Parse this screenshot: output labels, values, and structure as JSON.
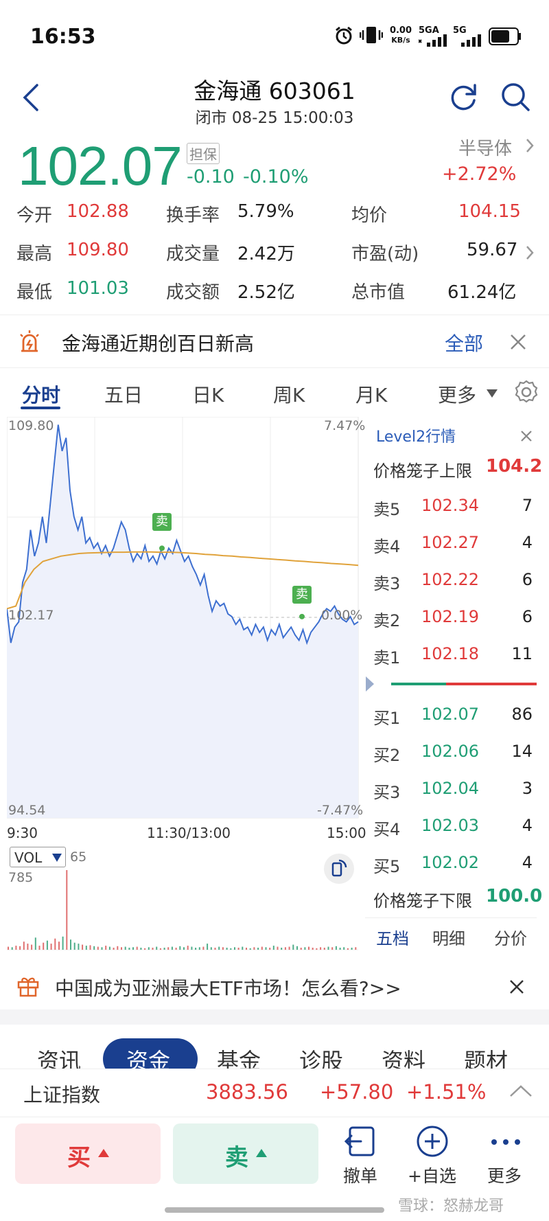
{
  "status_bar": {
    "time": "16:53",
    "net_speed": "0.00",
    "net_unit": "KB/s",
    "sim1": "5GA",
    "sim2": "5G"
  },
  "header": {
    "title": "金海通 603061",
    "subtitle": "闭市 08-25 15:00:03"
  },
  "quote": {
    "price": "102.07",
    "margin_badge": "担保",
    "change_abs": "-0.10",
    "change_pct": "-0.10%",
    "sector": "半导体",
    "sector_change": "+2.72%",
    "fields": [
      {
        "label": "今开",
        "value": "102.88",
        "color": "red"
      },
      {
        "label": "换手率",
        "value": "5.79%",
        "color": "dark"
      },
      {
        "label": "均价",
        "value": "104.15",
        "color": "red"
      },
      {
        "label": "最高",
        "value": "109.80",
        "color": "red"
      },
      {
        "label": "成交量",
        "value": "2.42万",
        "color": "dark"
      },
      {
        "label": "市盈(动)",
        "value": "59.67",
        "color": "dark"
      },
      {
        "label": "最低",
        "value": "101.03",
        "color": "green"
      },
      {
        "label": "成交额",
        "value": "2.52亿",
        "color": "dark"
      },
      {
        "label": "总市值",
        "value": "61.24亿",
        "color": "dark"
      }
    ]
  },
  "news": {
    "text": "金海通近期创百日新高",
    "link": "全部"
  },
  "chart_tabs": [
    "分时",
    "五日",
    "日K",
    "周K",
    "月K",
    "更多"
  ],
  "chart_data": {
    "type": "line",
    "y_top": "109.80",
    "y_mid": "102.17",
    "y_bottom": "94.54",
    "pct_top": "7.47%",
    "pct_mid": "0.00%",
    "pct_bottom": "-7.47%",
    "x_labels": [
      "9:30",
      "11:30/13:00",
      "15:00"
    ],
    "ylim": [
      94.54,
      109.8
    ],
    "series": [
      {
        "values": [
          102.5,
          101.2,
          101.8,
          102.0,
          103.5,
          104.0,
          105.5,
          104.5,
          105.0,
          106.0,
          105.0,
          106.5,
          108.0,
          109.5,
          108.5,
          109.0,
          107.0,
          106.0,
          105.5,
          106.0,
          105.0,
          105.2,
          104.8,
          105.0,
          104.6,
          104.9,
          104.5,
          104.8,
          105.3,
          105.8,
          105.5,
          104.8,
          104.3,
          104.6,
          104.4,
          104.9,
          104.3,
          104.5,
          104.2,
          104.7,
          104.4,
          104.8,
          104.6,
          105.1,
          104.7,
          104.3,
          104.5,
          104.1,
          103.8,
          103.4,
          103.8,
          103.0,
          102.4,
          102.8,
          102.6,
          102.7,
          102.3,
          102.2,
          101.9,
          102.1,
          101.7,
          101.8,
          101.5,
          101.9,
          101.6,
          101.8,
          101.3,
          101.7,
          101.5,
          101.9,
          101.4,
          101.6,
          101.8,
          101.5,
          101.3,
          101.7,
          101.2,
          101.6,
          101.8,
          102.0,
          102.3,
          102.5,
          102.4,
          102.6,
          102.3,
          102.1,
          102.0,
          102.2,
          101.9,
          102.0
        ]
      },
      {
        "values": [
          102.5,
          102.6,
          103.5,
          104.0,
          104.3,
          104.4,
          104.5,
          104.55,
          104.6,
          104.62,
          104.63,
          104.64,
          104.65,
          104.65,
          104.66,
          104.66,
          104.66,
          104.65,
          104.65,
          104.64,
          104.62,
          104.6,
          104.57,
          104.55,
          104.52,
          104.5,
          104.47,
          104.45,
          104.42,
          104.4,
          104.37,
          104.35,
          104.32,
          104.3,
          104.27,
          104.25,
          104.22,
          104.2,
          104.18,
          104.15
        ]
      }
    ],
    "trade_markers": [
      "卖",
      "卖"
    ]
  },
  "volume": {
    "label": "VOL",
    "current": "65",
    "max": "785",
    "values": [
      30,
      25,
      40,
      35,
      80,
      60,
      50,
      120,
      40,
      70,
      90,
      60,
      110,
      80,
      130,
      785,
      100,
      70,
      60,
      50,
      40,
      45,
      35,
      30,
      25,
      40,
      30,
      20,
      35,
      25,
      30,
      20,
      25,
      30,
      20,
      15,
      25,
      20,
      30,
      15,
      20,
      25,
      30,
      20,
      35,
      25,
      40,
      30,
      20,
      25,
      30,
      60,
      25,
      20,
      30,
      25,
      20,
      15,
      25,
      20,
      30,
      20,
      15,
      25,
      20,
      30,
      25,
      20,
      40,
      30,
      20,
      25,
      30,
      50,
      35,
      20,
      25,
      30,
      20,
      15,
      25,
      20,
      30,
      25,
      35,
      20,
      25,
      15,
      20,
      25
    ]
  },
  "level2": {
    "title": "Level2行情",
    "upper_label": "价格笼子上限",
    "upper_value": "104.2",
    "lower_label": "价格笼子下限",
    "lower_value": "100.0",
    "asks": [
      {
        "label": "卖5",
        "price": "102.34",
        "vol": "7"
      },
      {
        "label": "卖4",
        "price": "102.27",
        "vol": "4"
      },
      {
        "label": "卖3",
        "price": "102.22",
        "vol": "6"
      },
      {
        "label": "卖2",
        "price": "102.19",
        "vol": "6"
      },
      {
        "label": "卖1",
        "price": "102.18",
        "vol": "11"
      }
    ],
    "bids": [
      {
        "label": "买1",
        "price": "102.07",
        "vol": "86"
      },
      {
        "label": "买2",
        "price": "102.06",
        "vol": "14"
      },
      {
        "label": "买3",
        "price": "102.04",
        "vol": "3"
      },
      {
        "label": "买4",
        "price": "102.03",
        "vol": "4"
      },
      {
        "label": "买5",
        "price": "102.02",
        "vol": "4"
      }
    ],
    "tabs": [
      "五档",
      "明细",
      "分价"
    ]
  },
  "promo": {
    "text": "中国成为亚洲最大ETF市场！怎么看?>>"
  },
  "bottom_tabs": [
    "资讯",
    "资金",
    "基金",
    "诊股",
    "资料",
    "题材"
  ],
  "index": {
    "name": "上证指数",
    "value": "3883.56",
    "change": "+57.80",
    "pct": "+1.51%"
  },
  "actions": {
    "buy": "买",
    "sell": "卖",
    "cancel": "撤单",
    "watch": "+自选",
    "more": "更多"
  },
  "watermark": "雪球：怒赫龙哥",
  "colors": {
    "up": "#e03a3a",
    "down": "#1f9e74",
    "accent": "#1a3f8f",
    "price_line": "#3d6fd0",
    "avg_line": "#e0a23a"
  }
}
